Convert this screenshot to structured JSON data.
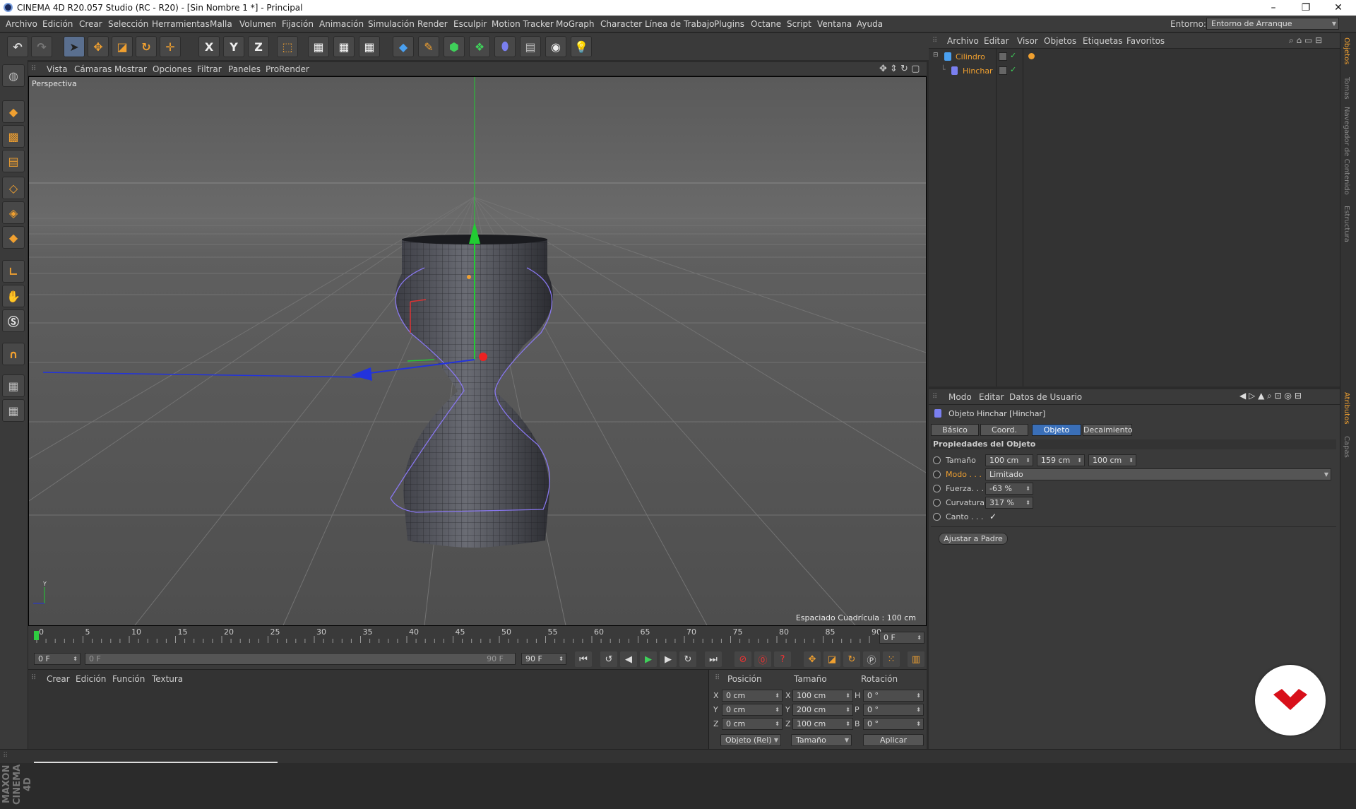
{
  "window": {
    "title": "CINEMA 4D R20.057 Studio (RC - R20) - [Sin Nombre 1 *] - Principal",
    "minimize": "–",
    "restore": "❐",
    "close": "✕"
  },
  "menubar": {
    "items": [
      "Archivo",
      "Edición",
      "Crear",
      "Selección",
      "Herramientas",
      "Malla",
      "Volumen",
      "Fijación",
      "Animación",
      "Simulación",
      "Render",
      "Esculpir",
      "Motion Tracker",
      "MoGraph",
      "Character",
      "Línea de Trabajo",
      "Plugins",
      "Octane",
      "Script",
      "Ventana",
      "Ayuda"
    ],
    "env_label": "Entorno:",
    "env_value": "Entorno de Arranque"
  },
  "toolbar": {
    "axis_x": "X",
    "axis_y": "Y",
    "axis_z": "Z"
  },
  "viewport": {
    "menu": [
      "Vista",
      "Cámaras",
      "Mostrar",
      "Opciones",
      "Filtrar",
      "Paneles",
      "ProRender"
    ],
    "label": "Perspectiva",
    "grid_spacing": "Espaciado Cuadrícula : 100 cm"
  },
  "timeline": {
    "ticks": [
      "0",
      "5",
      "10",
      "15",
      "20",
      "25",
      "30",
      "35",
      "40",
      "45",
      "50",
      "55",
      "60",
      "65",
      "70",
      "75",
      "80",
      "85",
      "90"
    ],
    "current_frame": "0 F",
    "start_field": "0 F",
    "range_start": "0 F",
    "range_end": "90 F",
    "end_field": "90 F"
  },
  "material_panel": {
    "menu": [
      "Crear",
      "Edición",
      "Función",
      "Textura"
    ]
  },
  "coordinates": {
    "headers": {
      "position": "Posición",
      "size": "Tamaño",
      "rotation": "Rotación"
    },
    "rows": [
      {
        "axis": "X",
        "pos": "0 cm",
        "size_axis": "X",
        "size": "100 cm",
        "rot_axis": "H",
        "rot": "0 °"
      },
      {
        "axis": "Y",
        "pos": "0 cm",
        "size_axis": "Y",
        "size": "200 cm",
        "rot_axis": "P",
        "rot": "0 °"
      },
      {
        "axis": "Z",
        "pos": "0 cm",
        "size_axis": "Z",
        "size": "100 cm",
        "rot_axis": "B",
        "rot": "0 °"
      }
    ],
    "mode_select": "Objeto (Rel)",
    "size_select": "Tamaño",
    "apply_button": "Aplicar"
  },
  "object_manager": {
    "menu": [
      "Archivo",
      "Editar",
      "Visor",
      "Objetos",
      "Etiquetas",
      "Favoritos"
    ],
    "objects": [
      {
        "name": "Cilindro",
        "check": "✓"
      },
      {
        "name": "Hinchar",
        "check": "✓"
      }
    ]
  },
  "attributes": {
    "menu": [
      "Modo",
      "Editar",
      "Datos de Usuario"
    ],
    "object_title": "Objeto Hinchar [Hinchar]",
    "tabs": [
      "Básico",
      "Coord.",
      "Objeto",
      "Decaimiento"
    ],
    "active_tab": "Objeto",
    "section_title": "Propiedades del Objeto",
    "size_label": "Tamaño",
    "size_x": "100 cm",
    "size_y": "159 cm",
    "size_z": "100 cm",
    "mode_label": "Modo . . .",
    "mode_value": "Limitado",
    "strength_label": "Fuerza. . .",
    "strength_value": "-63 %",
    "curvature_label": "Curvatura",
    "curvature_value": "317 %",
    "edge_label": "Canto . . .",
    "edge_value": "✓",
    "fit_parent_button": "Ajustar a Padre"
  },
  "right_tabs": [
    "Objetos",
    "Tomas",
    "Navegador de Contenido",
    "Estructura",
    "Atributos",
    "Capas"
  ],
  "side_logo_text": "MAXON CINEMA 4D",
  "colors": {
    "accent_orange": "#f0a030",
    "active_tab_blue": "#3a6fb8",
    "axis_y_green": "#22cc33",
    "axis_z_blue": "#2233dd",
    "bulge_cage": "#8877ee"
  }
}
